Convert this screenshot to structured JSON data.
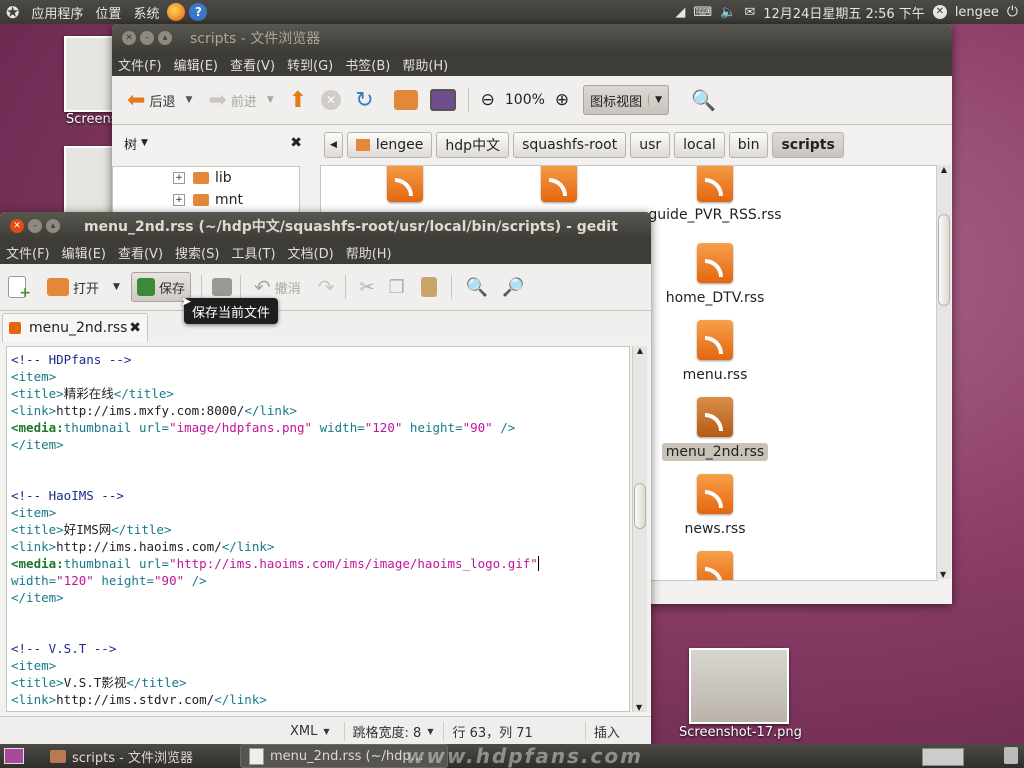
{
  "top_panel": {
    "applications": "应用程序",
    "places": "位置",
    "system": "系统",
    "datetime": "12月24日星期五  2:56 下午",
    "user": "lengee"
  },
  "desktop": {
    "icon_top_label": "Screens",
    "icon_bottom_label": "Screenshot-17.png"
  },
  "file_browser": {
    "title": "scripts - 文件浏览器",
    "menu": [
      "文件(F)",
      "编辑(E)",
      "查看(V)",
      "转到(G)",
      "书签(B)",
      "帮助(H)"
    ],
    "back": "后退",
    "forward": "前进",
    "zoom": "100%",
    "view_mode": "图标视图",
    "sidebar_title": "树",
    "tree": [
      {
        "name": "lib"
      },
      {
        "name": "mnt"
      }
    ],
    "path": [
      "lengee",
      "hdp中文",
      "squashfs-root",
      "usr",
      "local",
      "bin",
      "scripts"
    ],
    "files": [
      {
        "name": "guide_PVR_RSS.rss"
      },
      {
        "name": "home_DTV.rss"
      },
      {
        "name": "menu.rss"
      },
      {
        "name": "menu_2nd.rss",
        "selected": true
      },
      {
        "name": "news.rss"
      }
    ]
  },
  "gedit": {
    "title": "menu_2nd.rss (~/hdp中文/squashfs-root/usr/local/bin/scripts) - gedit",
    "menu": [
      "文件(F)",
      "编辑(E)",
      "查看(V)",
      "搜索(S)",
      "工具(T)",
      "文档(D)",
      "帮助(H)"
    ],
    "open": "打开",
    "save": "保存",
    "undo": "撤消",
    "tooltip": "保存当前文件",
    "tab": "menu_2nd.rss",
    "status": {
      "language": "XML",
      "tab_width": "跳格宽度: 8",
      "position": "行 63，列 71",
      "mode": "插入"
    },
    "code": {
      "c1": "<!-- HDPfans -->",
      "item_open": "<item>",
      "item_close": "</item>",
      "title_open": "<title>",
      "title_close": "</title>",
      "link_open": "<link>",
      "link_close": "</link>",
      "media_ns": "<media:",
      "thumbnail": "thumbnail",
      "url_attr": " url=",
      "width_attr": " width=",
      "width_attr2": "width=",
      "height_attr": " height=",
      "close_tag": " />",
      "v120": "\"120\"",
      "v90": "\"90\"",
      "t1": "精彩在线",
      "l1": "http://ims.mxfy.com:8000/",
      "u1": "\"image/hdpfans.png\"",
      "c2": "<!-- HaoIMS -->",
      "t2": "好IMS网",
      "l2": "http://ims.haoims.com/",
      "u2": "\"http://ims.haoims.com/ims/image/haoims_logo.gif\"",
      "c3": "<!-- V.S.T -->",
      "t3": "V.S.T影视",
      "l3": "http://ims.stdvr.com/"
    }
  },
  "bottom_panel": {
    "task1": "scripts - 文件浏览器",
    "task2": "menu_2nd.rss (~/hdp…",
    "watermark": "www.hdpfans.com"
  }
}
